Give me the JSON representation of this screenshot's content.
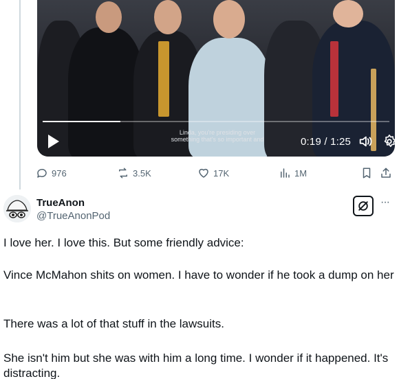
{
  "video": {
    "caption_line1": "Linda, you're presiding over",
    "caption_line2": "something that's so important and",
    "time": "0:19 / 1:25",
    "progress_fraction": 0.224
  },
  "actions": {
    "replies": "976",
    "reposts": "3.5K",
    "likes": "17K",
    "views": "1M"
  },
  "reply": {
    "author_name": "TrueAnon",
    "author_handle": "@TrueAnonPod",
    "more_label": "···",
    "paragraphs": [
      "I love her. I love this. But some friendly advice:",
      " Vince McMahon shits on women. I have to wonder if he took a dump on her",
      " There was a lot of that stuff in the lawsuits.",
      "She isn't him but she was with him a long time. I wonder if it happened. It's distracting."
    ]
  },
  "colors": {
    "text_primary": "#0f1419",
    "text_secondary": "#536471",
    "thread_line": "#cfd9de"
  }
}
